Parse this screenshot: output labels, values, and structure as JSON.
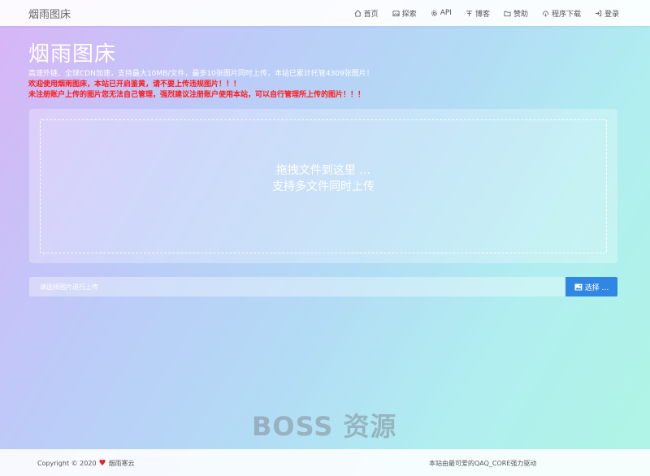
{
  "site": {
    "brand": "烟雨图床"
  },
  "nav": {
    "items": [
      {
        "label": "首页",
        "icon": "home-icon"
      },
      {
        "label": "探索",
        "icon": "image-icon"
      },
      {
        "label": "API",
        "icon": "gear-icon"
      },
      {
        "label": "博客",
        "icon": "blog-icon"
      },
      {
        "label": "赞助",
        "icon": "folder-icon"
      },
      {
        "label": "程序下载",
        "icon": "cloud-download-icon"
      },
      {
        "label": "登录",
        "icon": "login-icon"
      }
    ]
  },
  "hero": {
    "title": "烟雨图床",
    "info": "高速外链、全球CDN加速，支持最大10MB/文件，最多10张图片同时上传，本站已累计托管4309张图片！",
    "warning1": "欢迎使用烟雨图床，本站已开启鉴黄，请不要上传违规图片！！！",
    "warning2": "未注册账户上传的图片您无法自己管理，强烈建议注册账户使用本站，可以自行管理所上传的图片！！！"
  },
  "dropzone": {
    "line1": "拖拽文件到这里 …",
    "line2": "支持多文件同时上传"
  },
  "upload": {
    "placeholder": "请选择图片进行上传",
    "button_label": "选择 …"
  },
  "watermark": "BOSS 资源",
  "footer": {
    "copyright": "Copyright © 2020",
    "owner": "烟雨寒云",
    "powered": "本站由最可爱的QAQ_CORE强力驱动"
  },
  "colors": {
    "accent": "#2f86e3",
    "warning": "#ff1a1a",
    "heart": "#e02424"
  }
}
